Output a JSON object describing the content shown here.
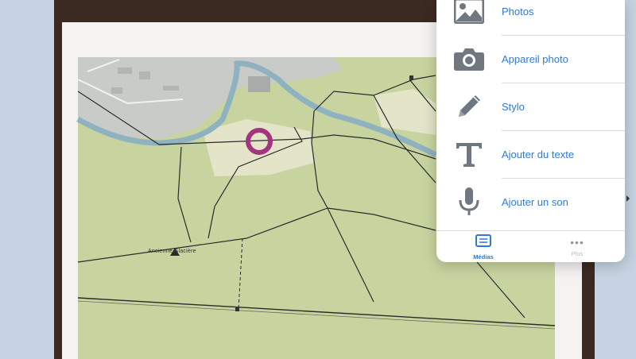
{
  "menu": {
    "items": [
      {
        "label": "Photos",
        "icon": "photo-icon"
      },
      {
        "label": "Appareil photo",
        "icon": "camera-icon"
      },
      {
        "label": "Stylo",
        "icon": "pen-icon"
      },
      {
        "label": "Ajouter du texte",
        "icon": "text-icon"
      },
      {
        "label": "Ajouter un son",
        "icon": "microphone-icon"
      }
    ]
  },
  "tabs": [
    {
      "label": "Médias",
      "icon": "media-icon",
      "active": true
    },
    {
      "label": "Plus",
      "icon": "more-dots-icon",
      "active": false
    }
  ],
  "map": {
    "place_label": "Ancienne Glacière"
  },
  "colors": {
    "accent": "#2f7ad8",
    "icon_gray": "#6f7780",
    "marker": "#a3357f",
    "river": "#8fb2c0",
    "field": "#c7d4a0"
  }
}
